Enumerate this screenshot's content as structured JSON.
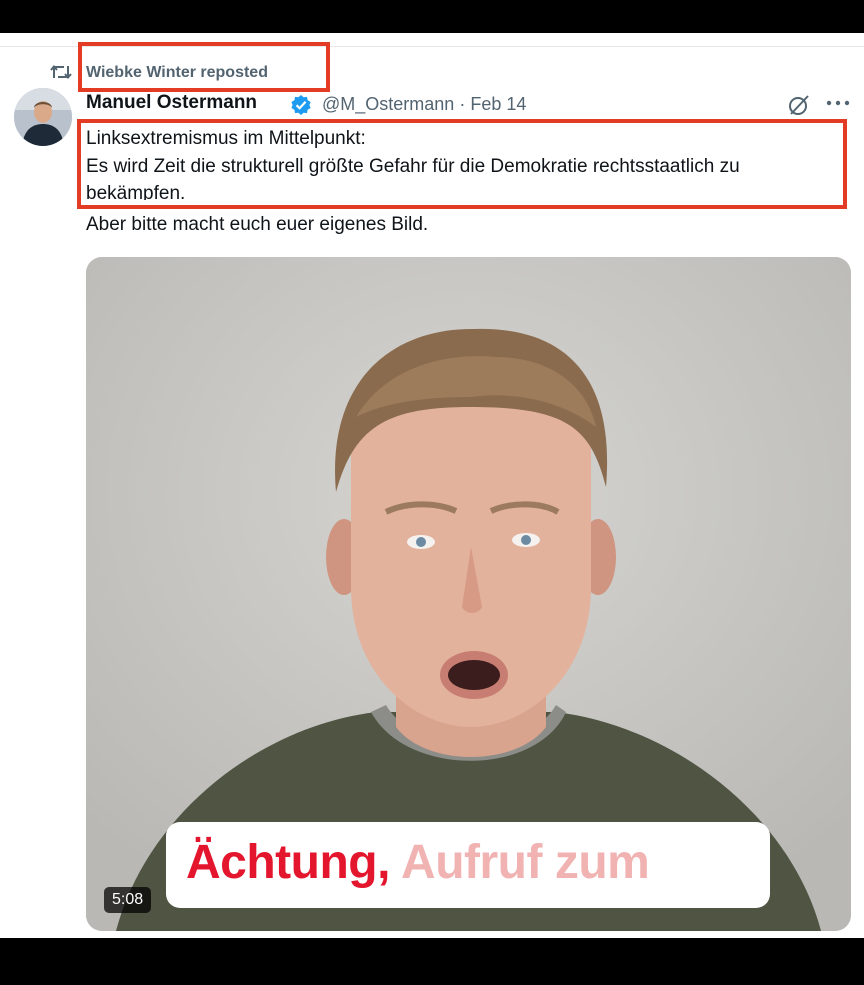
{
  "repost": {
    "text": "Wiebke Winter reposted",
    "icon": "repost-icon"
  },
  "author": {
    "name": "Manuel Ostermann",
    "verified_icon": "verified-badge-icon",
    "handle": "@M_Ostermann",
    "separator": "·",
    "date": "Feb 14"
  },
  "actions": {
    "grok_icon": "grok-icon",
    "more_icon": "more-icon"
  },
  "post": {
    "line1": "Linksextremismus im Mittelpunkt:",
    "line2": "Es wird Zeit die strukturell größte Gefahr für die Demokratie rechtsstaatlich zu",
    "line3": "bekämpfen.",
    "line4": "Aber bitte macht euch euer eigenes Bild."
  },
  "video": {
    "caption_part1": "Ächtung,",
    "caption_part2": "Aufruf zum",
    "duration": "5:08"
  },
  "colors": {
    "highlight_box": "#e33b24",
    "verified": "#1d9bf0",
    "caption_red": "#e3162d",
    "caption_pink": "#f1b2b2"
  }
}
